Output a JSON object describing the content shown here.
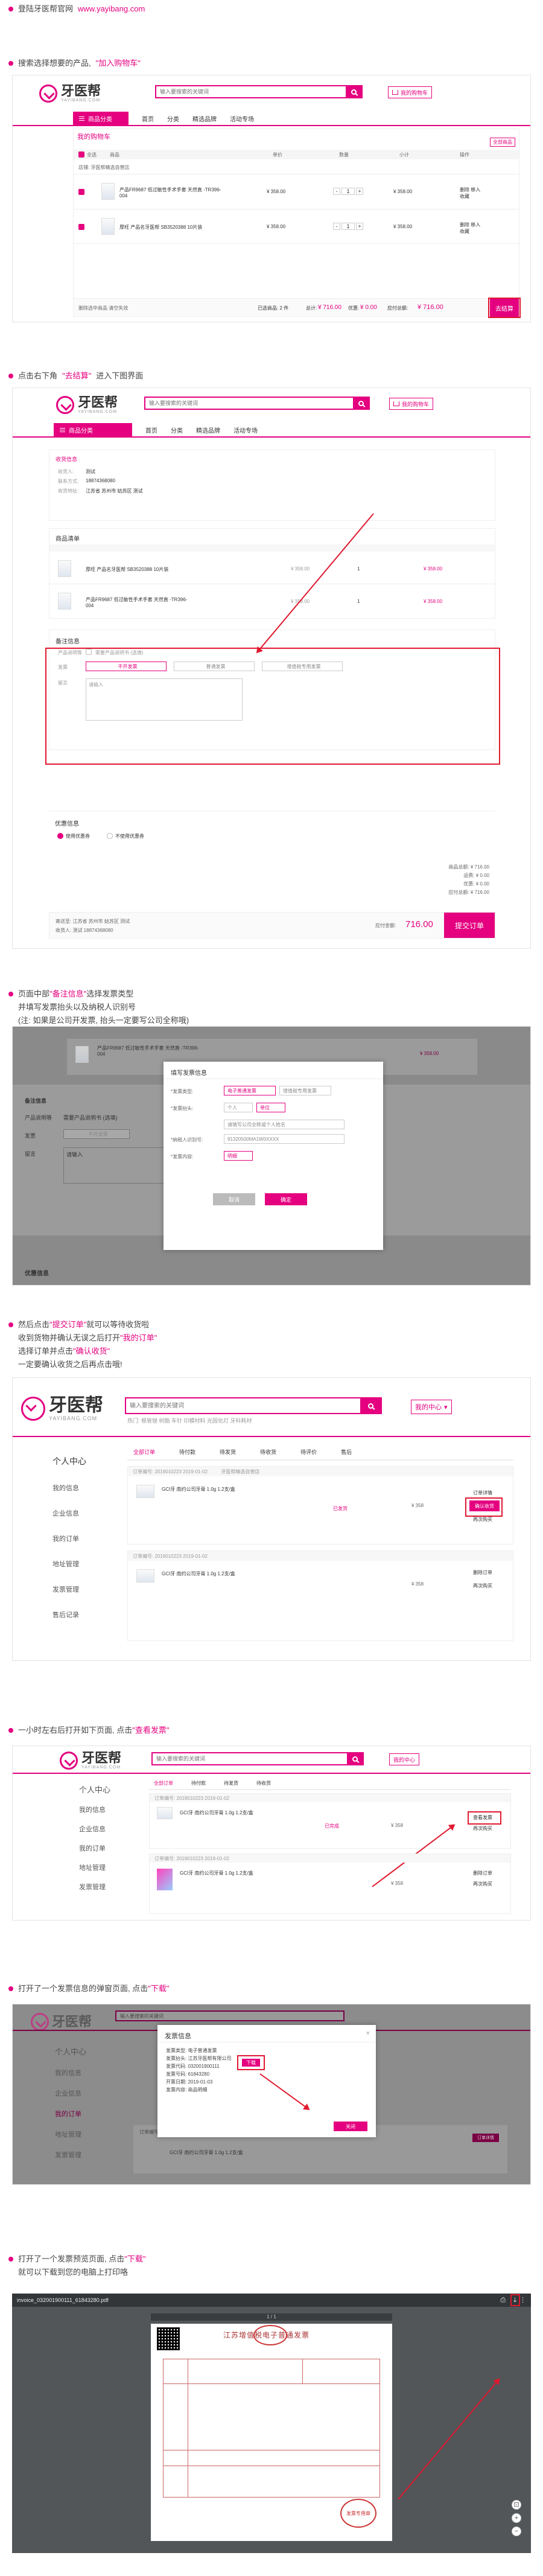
{
  "step1": {
    "text": "登陆牙医帮官网",
    "url": "www.yayibang.com"
  },
  "step2": {
    "text_before": "搜索选择想要的产品,",
    "highlight": "\"加入购物车\""
  },
  "brand": {
    "name": "牙医帮",
    "sub": "YAYIBANG.COM"
  },
  "search": {
    "placeholder": "输入要搜索的关键词",
    "placeholder_long": "输入要搜索的关键词",
    "hint": "热门: 根管锉 树脂 车针 印模材料 光固化灯 牙科耗材"
  },
  "cart_btn": "我的购物车",
  "my_center_btn": "我的中心",
  "nav": {
    "category": "商品分类",
    "items": [
      "首页",
      "分类",
      "精选品牌",
      "活动专场"
    ]
  },
  "cart": {
    "title": "我的购物车",
    "tag": "全部商品",
    "headers": [
      "全选",
      "商品",
      "单价",
      "数量",
      "小计",
      "操作"
    ],
    "shop": "店铺: 牙医帮精选自营店",
    "items": [
      {
        "name": "产品FR9687 低过敏性手术手套 天然直 -TR396-004",
        "price": "¥ 358.00",
        "qty": "1",
        "subtotal": "¥ 358.00",
        "op": "删除 移入收藏"
      },
      {
        "name": "厚旺 产品名牙医帮 SB3520388 10片装",
        "price": "¥ 358.00",
        "qty": "1",
        "subtotal": "¥ 358.00",
        "op": "删除 移入收藏"
      }
    ],
    "footer_left": "删除选中商品  清空失效",
    "selected": "已选商品: 2 件",
    "total_label": "总计:",
    "total": "¥ 716.00",
    "saved_label": "优惠:",
    "saved": "¥ 0.00",
    "pay_label": "应付总额:",
    "pay": "¥ 716.00",
    "checkout": "去结算"
  },
  "step3": {
    "text_before": "点击右下角",
    "highlight": "\"去结算\"",
    "text_after": "进入下图界面"
  },
  "checkout": {
    "address_title": "收货信息",
    "address_rows": [
      {
        "label": "收货人:",
        "value": "测试"
      },
      {
        "label": "联系方式:",
        "value": "18874368080"
      },
      {
        "label": "收货地址:",
        "value": "江苏省 苏州市 姑苏区 测试"
      }
    ],
    "list_title": "商品清单",
    "items": [
      {
        "name": "厚旺 产品名牙医帮 SB3520388 10片装",
        "price": "¥ 358.00",
        "qty": "1",
        "total": "¥ 358.00"
      },
      {
        "name": "产品FR9687 低过敏性手术手套 天然直 -TR396-004",
        "price": "¥ 358.00",
        "qty": "1",
        "total": "¥ 358.00"
      }
    ],
    "remark_title": "备注信息",
    "invoice_label": "产品说明等",
    "invoice_desc": "需要产品说明书 (选填)",
    "invoice_type_label": "发票",
    "invoice_opts": [
      "不开发票",
      "普通发票",
      "增值税专用发票"
    ],
    "remark_label": "留言",
    "remark_placeholder": "请输入",
    "coupon_title": "优惠信息",
    "coupon_opts": [
      "使用优惠券",
      "不使用优惠券"
    ],
    "sums": [
      {
        "label": "商品总额:",
        "value": "¥ 716.00"
      },
      {
        "label": "运费:",
        "value": "¥ 0.00"
      },
      {
        "label": "优惠:",
        "value": "¥ 0.00"
      },
      {
        "label": "应付总额:",
        "value": "¥ 716.00"
      }
    ],
    "pay_label": "应付金额:",
    "pay": "716.00",
    "submit": "提交订单",
    "addr_footer": "寄送至: 江苏省 苏州市 姑苏区 测试",
    "addr_footer2": "收货人: 测试 18874368080"
  },
  "step4": {
    "l1_before": "页面中部",
    "l1_hl": "\"备注信息\"",
    "l1_after": "选择发票类型",
    "l2": "并填写发票抬头以及纳税人识别号",
    "l3": "(注: 如果是公司开发票, 抬头一定要写公司全称哦)"
  },
  "invoice_modal": {
    "title": "填写发票信息",
    "rows": [
      {
        "label": "*发票类型:",
        "value": "电子普通发票",
        "value2": "增值税专用发票"
      },
      {
        "label": "*发票抬头:",
        "value": "个人",
        "value2": "单位"
      },
      {
        "label": "",
        "value": "请填写公司全称或个人姓名"
      },
      {
        "label": "*纳税人识别号:",
        "value": "91320500MA1W0XXXX"
      },
      {
        "label": "*发票内容:",
        "value": "明细"
      }
    ],
    "cancel": "取消",
    "ok": "确定"
  },
  "step5": {
    "l1_before": "然后点击",
    "l1_hl": "\"提交订单\"",
    "l1_after": "就可以等待收货啦",
    "l2_before": "收到货物并确认无误之后打开",
    "l2_hl": "\"我的订单\"",
    "l3_before": "选择订单并点击",
    "l3_hl": "\"确认收货\"",
    "l4": "一定要确认收货之后再点击哦!"
  },
  "orders": {
    "center": "个人中心",
    "menu": [
      "我的信息",
      "企业信息",
      "我的订单",
      "地址管理",
      "发票管理",
      "售后记录"
    ],
    "tabs": [
      "全部订单",
      "待付款",
      "待发货",
      "待收货",
      "待评价",
      "售后"
    ],
    "order_no": "订单编号: 2019010223  2019-01-02",
    "shop": "牙医帮精选自营店",
    "item_name": "GCI牙 南约公司牙膏 1.0g 1.2支/盒",
    "price": "¥ 358",
    "status": "已发货",
    "status2": "已完成",
    "btn_confirm": "确认收货",
    "btn_detail": "订单详情",
    "btn_invoice": "查看发票",
    "btn_del": "删除订单",
    "btn_buy": "再次购买"
  },
  "step6": {
    "before": "一小时左右后打开如下页面, 点击",
    "hl": "\"查看发票\""
  },
  "step7": {
    "before": "打开了一个发票信息的弹窗页面, 点击",
    "hl": "\"下载\""
  },
  "inv_popup": {
    "title": "发票信息",
    "rows": [
      "发票类型: 电子普通发票",
      "发票抬头: 江苏牙医帮有限公司",
      "发票代码: 032001900111",
      "发票号码: 61843280",
      "开票日期: 2019-01-03",
      "发票内容: 商品明细"
    ],
    "download": "下载",
    "close": "关闭"
  },
  "step8": {
    "before": "打开了一个发票预览页面, 点击",
    "hl": "\"下载\"",
    "l2": "就可以下载到您的电脑上打印咯"
  },
  "pdf": {
    "filename": "invoice_032001900111_61843280.pdf",
    "page": "1 / 1",
    "title": "江苏增值税电子普通发票",
    "seal": "发票专用章"
  }
}
